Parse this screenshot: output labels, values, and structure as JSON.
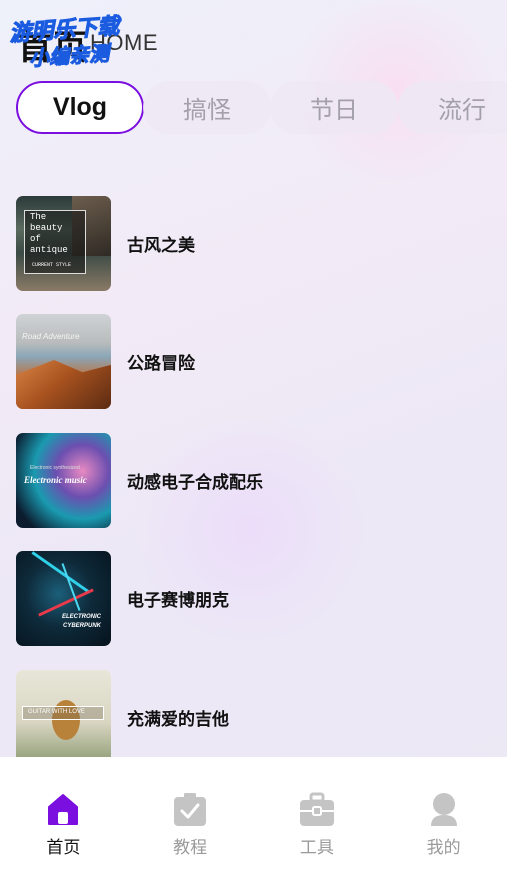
{
  "header": {
    "title": "首页",
    "subtitle": "HOME",
    "watermark_line1": "游明乐下载",
    "watermark_line2": "小编亲测"
  },
  "tabs": [
    {
      "label": "Vlog",
      "active": true
    },
    {
      "label": "搞怪",
      "active": false
    },
    {
      "label": "节日",
      "active": false
    },
    {
      "label": "流行",
      "active": false
    }
  ],
  "list": [
    {
      "title": "古风之美",
      "thumb_text": [
        "The",
        "beauty",
        "of",
        "antique"
      ],
      "thumb_small": "CURRENT STYLE"
    },
    {
      "title": "公路冒险",
      "thumb_text": [
        "Road Adventure"
      ]
    },
    {
      "title": "动感电子合成配乐",
      "thumb_text": [
        "Electronic music"
      ],
      "thumb_small": "Electronic synthesized"
    },
    {
      "title": "电子赛博朋克",
      "thumb_text": [
        "ELECTRONIC",
        "CYBERPUNK"
      ]
    },
    {
      "title": "充满爱的吉他",
      "thumb_text": [
        "GUITAR WITH LOVE"
      ]
    }
  ],
  "bottom_nav": [
    {
      "label": "首页",
      "icon": "home-icon",
      "active": true
    },
    {
      "label": "教程",
      "icon": "tutorial-icon",
      "active": false
    },
    {
      "label": "工具",
      "icon": "toolbox-icon",
      "active": false
    },
    {
      "label": "我的",
      "icon": "profile-icon",
      "active": false
    }
  ],
  "colors": {
    "accent": "#7a0fe0",
    "inactive_icon": "#c4c4c4",
    "tab_inactive_text": "#a3a0ab"
  }
}
